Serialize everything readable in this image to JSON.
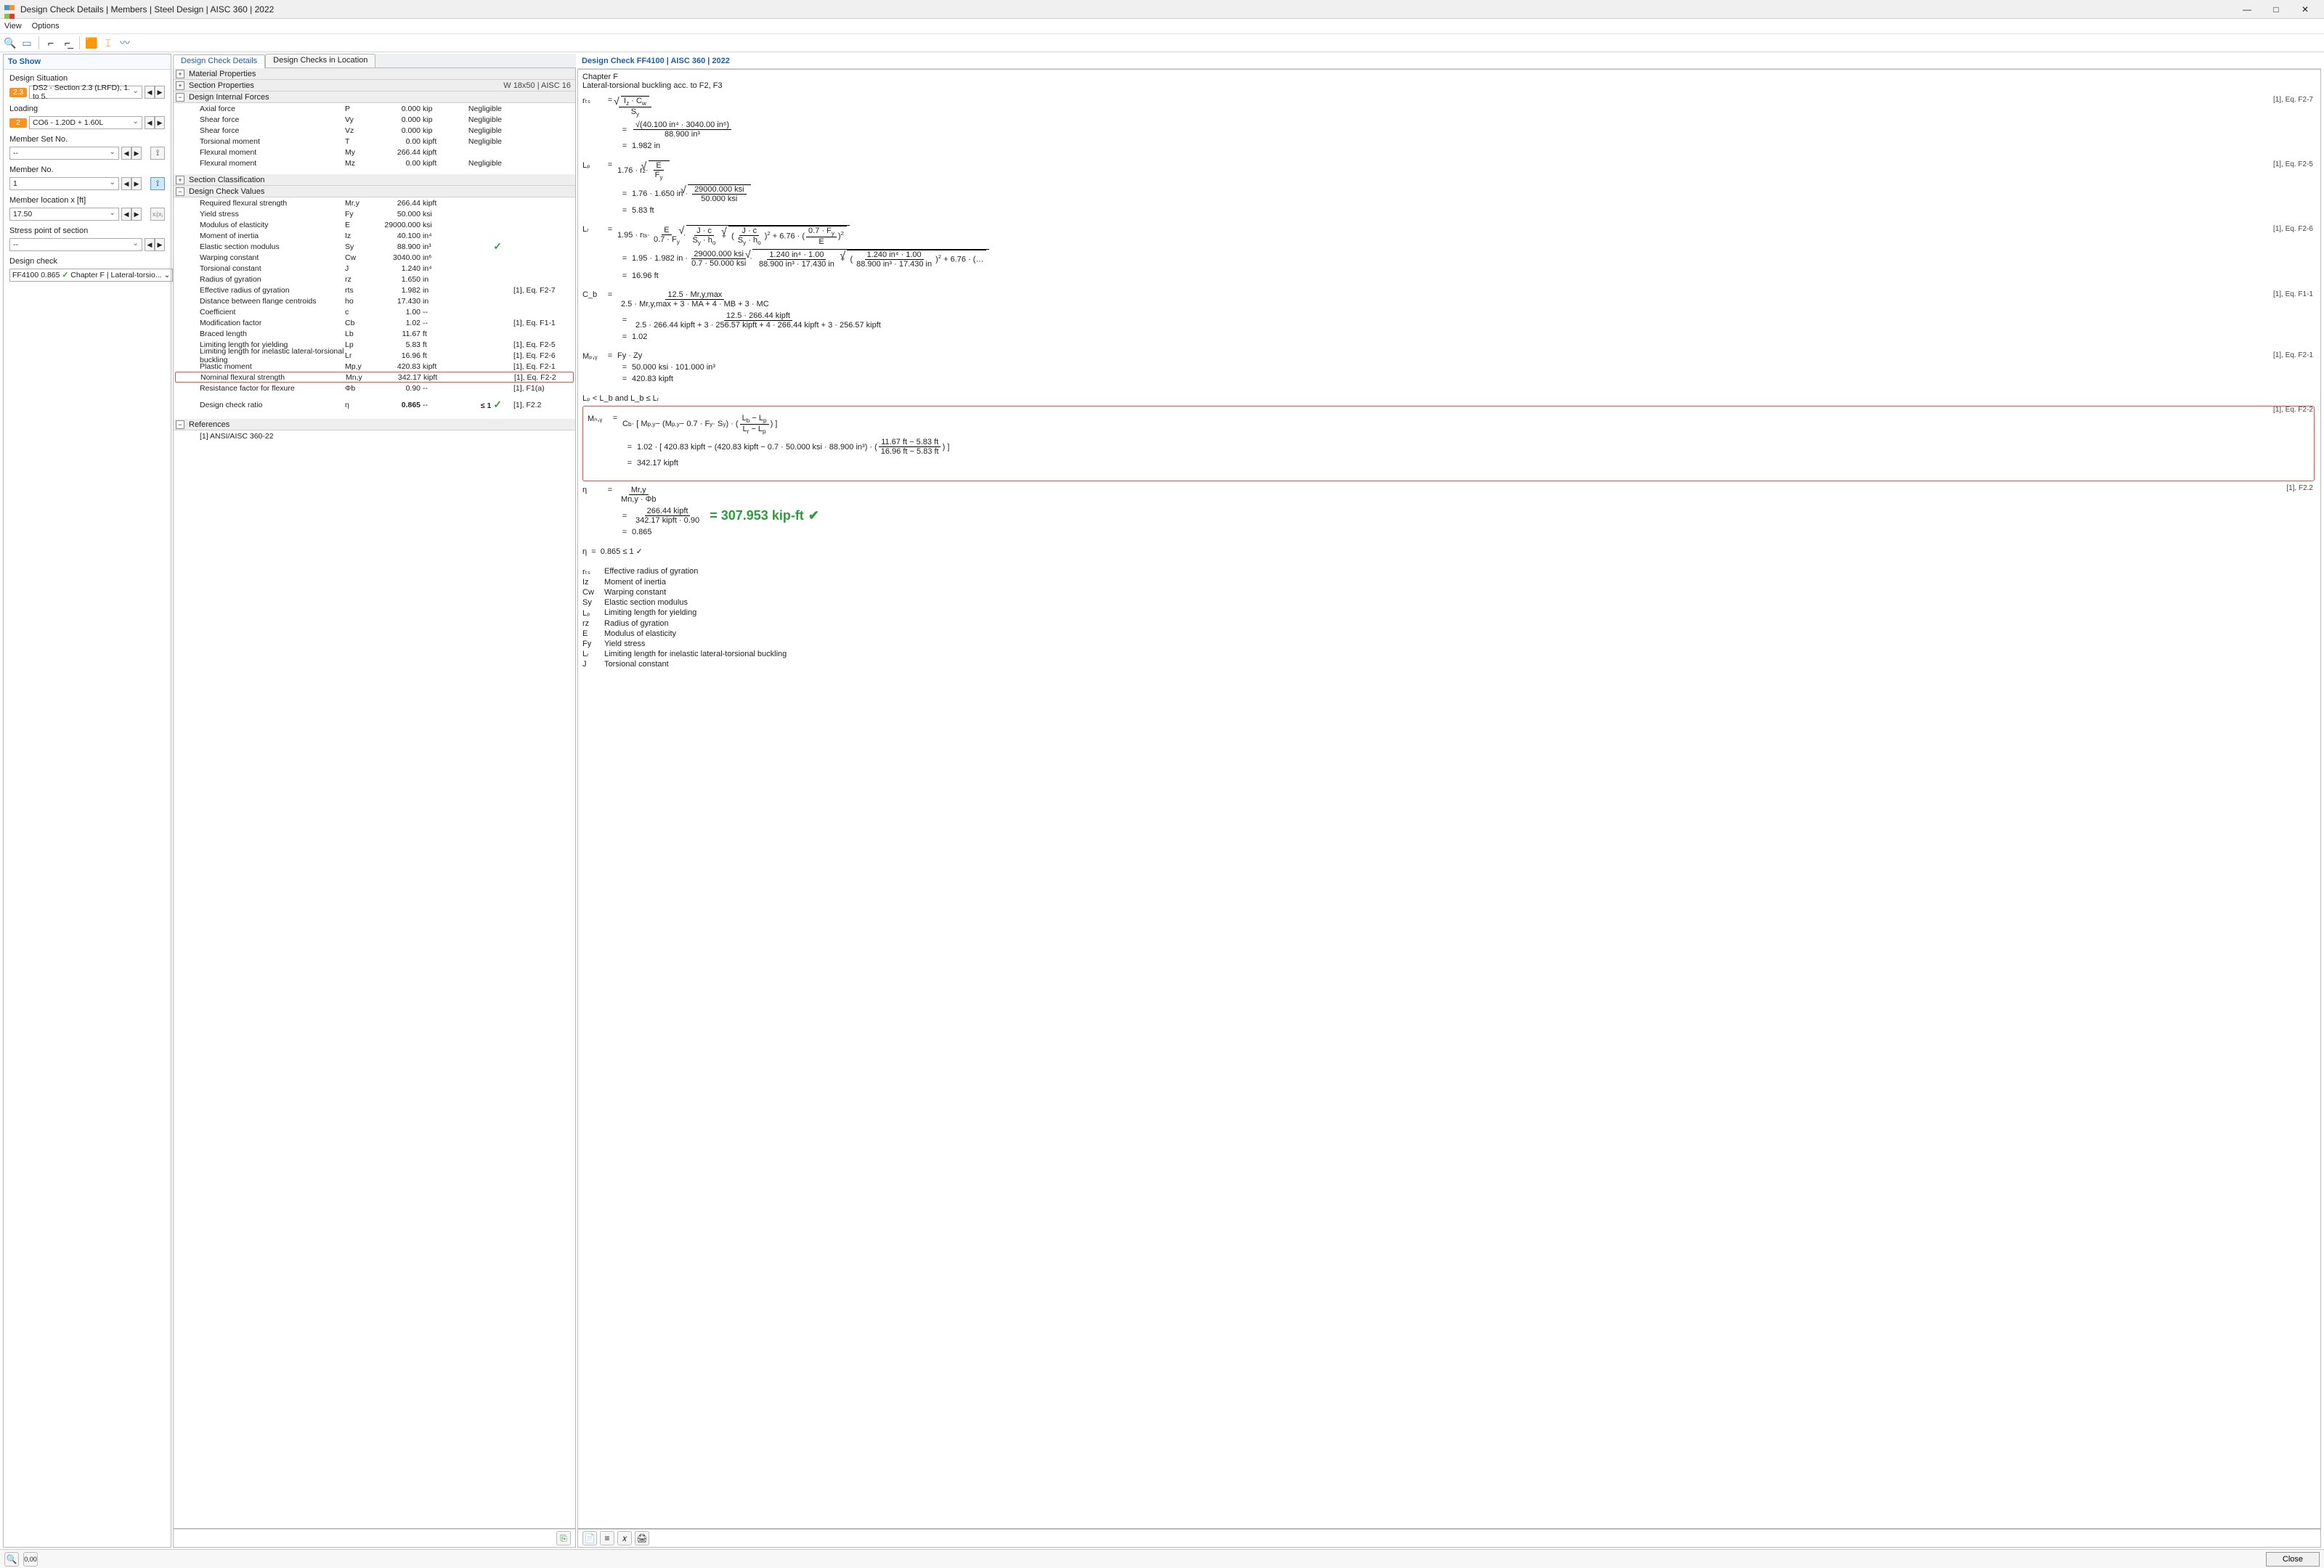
{
  "window": {
    "title": "Design Check Details | Members | Steel Design | AISC 360 | 2022",
    "menu": {
      "view": "View",
      "options": "Options"
    },
    "close_label": "Close"
  },
  "left": {
    "header": "To Show",
    "groups": {
      "design_situation": {
        "label": "Design Situation",
        "badge": "2.3",
        "value": "DS2 - Section 2.3 (LRFD), 1. to 5."
      },
      "loading": {
        "label": "Loading",
        "badge": "2",
        "value": "CO6 - 1.20D + 1.60L"
      },
      "member_set": {
        "label": "Member Set No.",
        "value": "-- "
      },
      "member_no": {
        "label": "Member No.",
        "value": "1"
      },
      "member_loc": {
        "label": "Member location x [ft]",
        "value": "17.50"
      },
      "stress_pt": {
        "label": "Stress point of section",
        "value": "-- "
      },
      "design_check": {
        "label": "Design check",
        "code": "FF4100",
        "ratio": "0.865",
        "desc": "Chapter F | Lateral-torsio..."
      }
    }
  },
  "mid": {
    "tabs": {
      "t1": "Design Check Details",
      "t2": "Design Checks in Location"
    },
    "sections": {
      "mat": "Material Properties",
      "sec": {
        "title": "Section Properties",
        "right": "W 18x50 | AISC 16"
      },
      "forces": "Design Internal Forces",
      "classif": "Section Classification",
      "values": "Design Check Values",
      "refs": "References",
      "ref_item": "[1]  ANSI/AISC 360-22"
    },
    "forces_rows": [
      {
        "l": "Axial force",
        "s": "P",
        "v": "0.000",
        "u": "kip",
        "e": "Negligible"
      },
      {
        "l": "Shear force",
        "s": "Vy",
        "v": "0.000",
        "u": "kip",
        "e": "Negligible"
      },
      {
        "l": "Shear force",
        "s": "Vz",
        "v": "0.000",
        "u": "kip",
        "e": "Negligible"
      },
      {
        "l": "Torsional moment",
        "s": "T",
        "v": "0.00",
        "u": "kipft",
        "e": "Negligible"
      },
      {
        "l": "Flexural moment",
        "s": "My",
        "v": "266.44",
        "u": "kipft",
        "e": ""
      },
      {
        "l": "Flexural moment",
        "s": "Mz",
        "v": "0.00",
        "u": "kipft",
        "e": "Negligible"
      }
    ],
    "value_rows": [
      {
        "l": "Required flexural strength",
        "s": "Mr,y",
        "v": "266.44",
        "u": "kipft",
        "r": ""
      },
      {
        "l": "Yield stress",
        "s": "Fy",
        "v": "50.000",
        "u": "ksi",
        "r": ""
      },
      {
        "l": "Modulus of elasticity",
        "s": "E",
        "v": "29000.000",
        "u": "ksi",
        "r": ""
      },
      {
        "l": "Moment of inertia",
        "s": "Iz",
        "v": "40.100",
        "u": "in⁴",
        "r": ""
      },
      {
        "l": "Elastic section modulus",
        "s": "Sy",
        "v": "88.900",
        "u": "in³",
        "r": "",
        "chk": true
      },
      {
        "l": "Warping constant",
        "s": "Cw",
        "v": "3040.00",
        "u": "in⁶",
        "r": ""
      },
      {
        "l": "Torsional constant",
        "s": "J",
        "v": "1.240",
        "u": "in⁴",
        "r": ""
      },
      {
        "l": "Radius of gyration",
        "s": "rz",
        "v": "1.650",
        "u": "in",
        "r": ""
      },
      {
        "l": "Effective radius of gyration",
        "s": "rts",
        "v": "1.982",
        "u": "in",
        "r": "[1], Eq. F2-7"
      },
      {
        "l": "Distance between flange centroids",
        "s": "ho",
        "v": "17.430",
        "u": "in",
        "r": ""
      },
      {
        "l": "Coefficient",
        "s": "c",
        "v": "1.00",
        "u": "--",
        "r": ""
      },
      {
        "l": "Modification factor",
        "s": "Cb",
        "v": "1.02",
        "u": "--",
        "r": "[1], Eq. F1-1"
      },
      {
        "l": "Braced length",
        "s": "Lb",
        "v": "11.67",
        "u": "ft",
        "r": ""
      },
      {
        "l": "Limiting length for yielding",
        "s": "Lp",
        "v": "5.83",
        "u": "ft",
        "r": "[1], Eq. F2-5"
      },
      {
        "l": "Limiting length for inelastic lateral-torsional buckling",
        "s": "Lr",
        "v": "16.96",
        "u": "ft",
        "r": "[1], Eq. F2-6"
      },
      {
        "l": "Plastic moment",
        "s": "Mp,y",
        "v": "420.83",
        "u": "kipft",
        "r": "[1], Eq. F2-1"
      },
      {
        "l": "Nominal flexural strength",
        "s": "Mn,y",
        "v": "342.17",
        "u": "kipft",
        "r": "[1], Eq. F2-2",
        "hl": true
      },
      {
        "l": "Resistance factor for flexure",
        "s": "Φb",
        "v": "0.90",
        "u": "--",
        "r": "[1], F1(a)"
      }
    ],
    "ratio_row": {
      "l": "Design check ratio",
      "s": "η",
      "v": "0.865",
      "u": "--",
      "e": "≤ 1",
      "r": "[1], F2.2",
      "chk": true
    }
  },
  "right": {
    "header": "Design Check FF4100 | AISC 360 | 2022",
    "sub1": "Chapter F",
    "sub2": "Lateral-torsional buckling acc. to F2, F3",
    "refs": {
      "f27": "[1], Eq. F2-7",
      "f25": "[1], Eq. F2-5",
      "f26": "[1], Eq. F2-6",
      "f11": "[1], Eq. F1-1",
      "f21": "[1], Eq. F2-1",
      "f22a": "[1], Eq. F2-2",
      "f22b": "[1], F2.2"
    },
    "eq": {
      "rts": {
        "sym": "rₜₛ",
        "l1": "√(Iz · Cw) / Sy",
        "l2_num": "√(40.100 in⁴ · 3040.00 in⁶)",
        "l2_den": "88.900 in³",
        "res": "1.982 in"
      },
      "lp": {
        "sym": "Lₚ",
        "l1": "1.76 · rz · √(E / Fy)",
        "l2": "1.76 · 1.650 in · √(29000.000 ksi / 50.000 ksi)",
        "res": "5.83 ft"
      },
      "lr": {
        "sym": "Lᵣ",
        "l1": "1.95 · rts · E/(0.7·Fy) · √( J·c/(Sy·ho) + √( (J·c/(Sy·ho))² + 6.76·(0.7·Fy/E)² ) )",
        "l2": "1.95 · 1.982 in · 29000.000 ksi/(0.7·50.000 ksi) · √( 1.240 in⁴·1.00/(88.900 in³·17.430 in) + √( (1.240 in⁴·1.00/(88.900 in³·17.430 in))² + 6.76·(…",
        "res": "16.96 ft"
      },
      "cb": {
        "sym": "C_b",
        "l1_num": "12.5 · Mr,y,max",
        "l1_den": "2.5 · Mr,y,max + 3 · MA + 4 · MB + 3 · MC",
        "l2_num": "12.5 · 266.44 kipft",
        "l2_den": "2.5 · 266.44 kipft + 3 · 256.57 kipft + 4 · 266.44 kipft + 3 · 256.57 kipft",
        "res": "1.02"
      },
      "mpy": {
        "sym": "Mₚ,ᵧ",
        "l1": "Fy · Zy",
        "l2": "50.000 ksi · 101.000 in³",
        "res": "420.83 kipft"
      },
      "cond": "Lₚ < L_b  and  L_b ≤ Lᵣ",
      "mny": {
        "sym": "Mₙ,ᵧ",
        "l1": "C_b · [ Mp,y − (Mp,y − 0.7 · Fy · Sy) · ( (L_b − Lp)/(Lr − Lp) ) ]",
        "l2": "1.02 · [ 420.83 kipft − (420.83 kipft − 0.7 · 50.000 ksi · 88.900 in³) · ( (11.67 ft − 5.83 ft)/(16.96 ft − 5.83 ft) ) ]",
        "res": "342.17 kipft"
      },
      "eta": {
        "sym": "η",
        "l1_num": "Mr,y",
        "l1_den": "Mn,y · Φb",
        "l2_num": "266.44 kipft",
        "l2_den": "342.17 kipft · 0.90",
        "res": "0.865",
        "cond": "0.865 ≤ 1 ✓"
      },
      "green": "= 307.953 kip-ft"
    },
    "legend": [
      {
        "s": "rₜₛ",
        "d": "Effective radius of gyration"
      },
      {
        "s": "Iz",
        "d": "Moment of inertia"
      },
      {
        "s": "Cw",
        "d": "Warping constant"
      },
      {
        "s": "Sy",
        "d": "Elastic section modulus"
      },
      {
        "s": "Lₚ",
        "d": "Limiting length for yielding"
      },
      {
        "s": "rz",
        "d": "Radius of gyration"
      },
      {
        "s": "E",
        "d": "Modulus of elasticity"
      },
      {
        "s": "Fy",
        "d": "Yield stress"
      },
      {
        "s": "Lᵣ",
        "d": "Limiting length for inelastic lateral-torsional buckling"
      },
      {
        "s": "J",
        "d": "Torsional constant"
      }
    ]
  }
}
